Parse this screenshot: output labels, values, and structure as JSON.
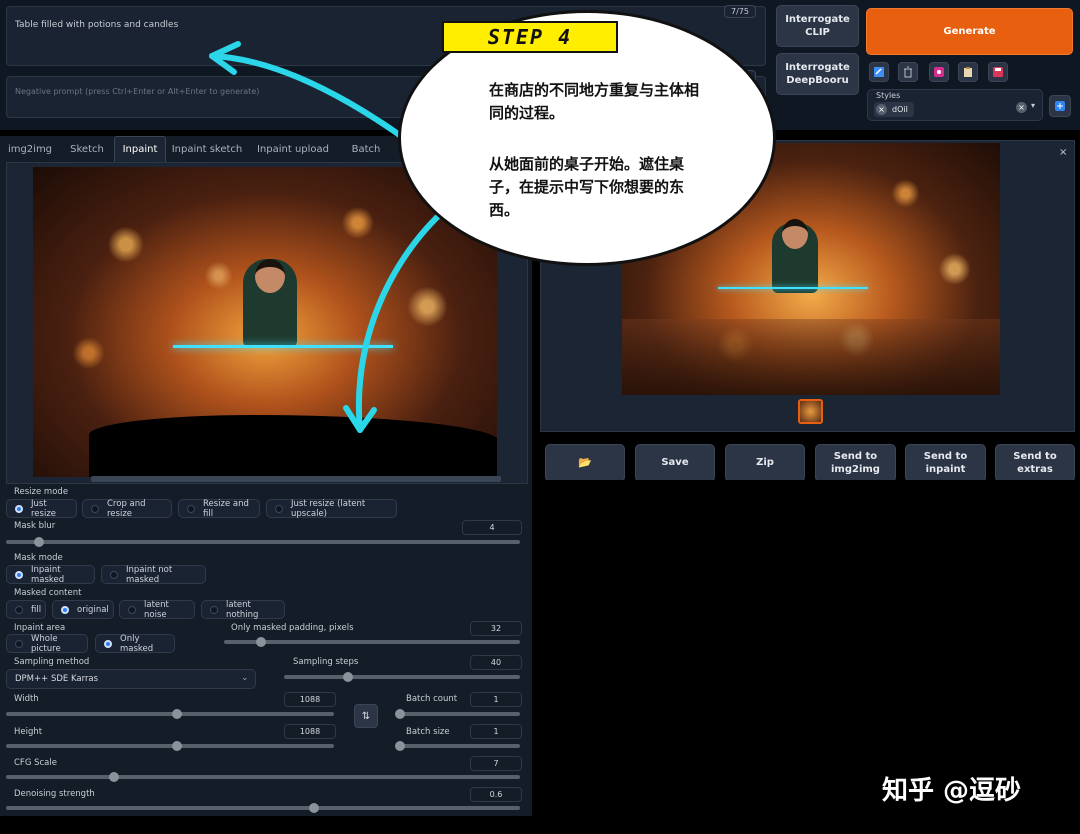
{
  "prompt": {
    "value": "Table filled with potions and candles",
    "token_count": "7/75"
  },
  "negative_prompt": {
    "placeholder": "Negative prompt (press Ctrl+Enter or Alt+Enter to generate)"
  },
  "actions": {
    "interrogate_clip": "Interrogate\nCLIP",
    "interrogate_deepbooru": "Interrogate\nDeepBooru",
    "generate": "Generate"
  },
  "styles": {
    "label": "Styles",
    "selected": "dOil"
  },
  "tabs": [
    {
      "label": "img2img"
    },
    {
      "label": "Sketch"
    },
    {
      "label": "Inpaint"
    },
    {
      "label": "Inpaint sketch"
    },
    {
      "label": "Inpaint upload"
    },
    {
      "label": "Batch"
    }
  ],
  "resize_mode": {
    "label": "Resize mode",
    "options": [
      "Just resize",
      "Crop and resize",
      "Resize and fill",
      "Just resize (latent upscale)"
    ],
    "selected": "Just resize"
  },
  "mask_blur": {
    "label": "Mask blur",
    "value": "4",
    "fraction": 0.064
  },
  "mask_mode": {
    "label": "Mask mode",
    "options": [
      "Inpaint masked",
      "Inpaint not masked"
    ],
    "selected": "Inpaint masked"
  },
  "masked_content": {
    "label": "Masked content",
    "options": [
      "fill",
      "original",
      "latent noise",
      "latent nothing"
    ],
    "selected": "original"
  },
  "inpaint_area": {
    "label": "Inpaint area",
    "options": [
      "Whole picture",
      "Only masked"
    ],
    "selected": "Only masked"
  },
  "padding": {
    "label": "Only masked padding, pixels",
    "value": "32",
    "fraction": 0.125
  },
  "sampling_method": {
    "label": "Sampling method",
    "value": "DPM++ SDE Karras"
  },
  "sampling_steps": {
    "label": "Sampling steps",
    "value": "40",
    "fraction": 0.27
  },
  "width": {
    "label": "Width",
    "value": "1088",
    "fraction": 0.52
  },
  "height": {
    "label": "Height",
    "value": "1088",
    "fraction": 0.52
  },
  "batch_count": {
    "label": "Batch count",
    "value": "1",
    "fraction": 0.0
  },
  "batch_size": {
    "label": "Batch size",
    "value": "1",
    "fraction": 0.0
  },
  "cfg_scale": {
    "label": "CFG Scale",
    "value": "7",
    "fraction": 0.21
  },
  "denoising": {
    "label": "Denoising strength",
    "value": "0.6",
    "fraction": 0.6
  },
  "output_buttons": {
    "folder": "📂",
    "save": "Save",
    "zip": "Zip",
    "send_img2img": "Send to\nimg2img",
    "send_inpaint": "Send to inpaint",
    "send_extras": "Send to extras"
  },
  "annotation": {
    "step": "STEP 4",
    "text1": "在商店的不同地方重复与主体相同的过程。",
    "text2": "从她面前的桌子开始。遮住桌子，在提示中写下你想要的东西。"
  },
  "watermark": "知乎 @逗砂",
  "colors": {
    "generate": "#e8600f",
    "accent": "#2f7ff0",
    "arrow": "#2ad6e8",
    "step_bg": "#ffee00"
  }
}
